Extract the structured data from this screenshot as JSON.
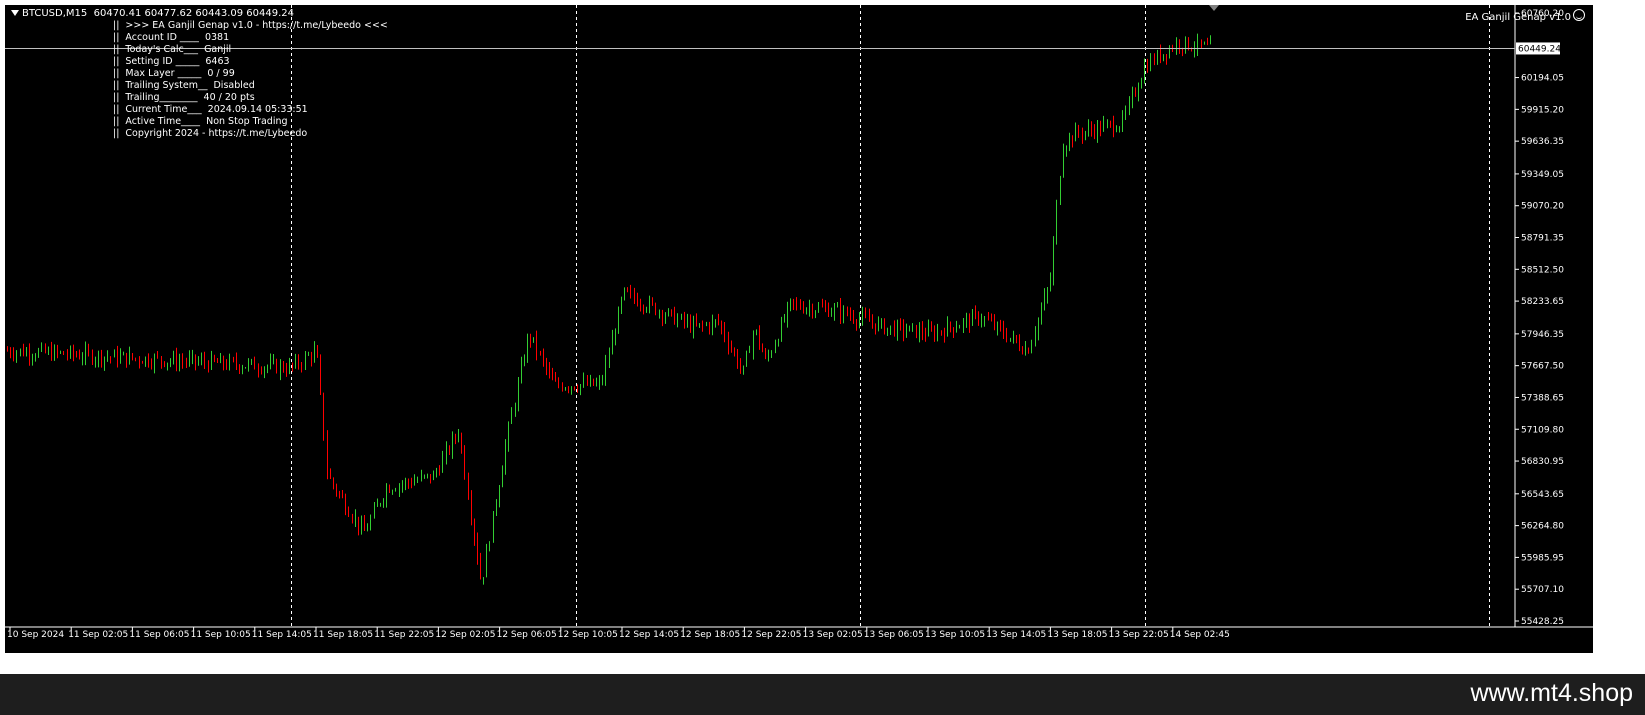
{
  "header": {
    "symbol": "BTCUSD,M15",
    "ohlc": "60470.41 60477.62 60443.09 60449.24"
  },
  "indicator_name": "EA Ganjil Genap v1.0",
  "ea_panel": [
    ">>> EA Ganjil Genap v1.0 - https://t.me/Lybeedo <<<",
    "Account ID ____  0381",
    "Today's Calc___  Ganjil",
    "Setting ID _____  6463",
    "Max Layer _____  0 / 99",
    "Trailing System__  Disabled",
    "Trailing________  40 / 20 pts",
    "Current Time___  2024.09.14 05:33:51",
    "Active Time____  Non Stop Trading",
    "Copyright 2024 - https://t.me/Lybeedo"
  ],
  "watermark": "www.mt4.shop",
  "colors": {
    "background": "#000000",
    "bull_candle": "#32cd32",
    "bear_candle": "#ff0000",
    "grid": "#ffffff",
    "bid_line": "#c0c0c0"
  },
  "chart_data": {
    "type": "candlestick",
    "symbol": "BTCUSD",
    "timeframe": "M15",
    "current_price": "60449.24",
    "y_ticks": [
      "60760.20",
      "60194.05",
      "59915.20",
      "59636.35",
      "59349.05",
      "59070.20",
      "58791.35",
      "58512.50",
      "58233.65",
      "57946.35",
      "57667.50",
      "57388.65",
      "57109.80",
      "56830.95",
      "56543.65",
      "56264.80",
      "55985.95",
      "55707.10",
      "55428.25"
    ],
    "x_ticks": [
      "10 Sep 2024",
      "11 Sep 02:05",
      "11 Sep 06:05",
      "11 Sep 10:05",
      "11 Sep 14:05",
      "11 Sep 18:05",
      "11 Sep 22:05",
      "12 Sep 02:05",
      "12 Sep 06:05",
      "12 Sep 10:05",
      "12 Sep 14:05",
      "12 Sep 18:05",
      "12 Sep 22:05",
      "13 Sep 02:05",
      "13 Sep 06:05",
      "13 Sep 10:05",
      "13 Sep 14:05",
      "13 Sep 18:05",
      "13 Sep 22:05",
      "14 Sep 02:45"
    ],
    "ylim": [
      55428.25,
      60760.2
    ],
    "day_separators": [
      "11 Sep 00:00",
      "12 Sep 00:00",
      "13 Sep 00:00",
      "14 Sep 00:00"
    ],
    "close_path": [
      [
        "10 Sep 2024",
        57800
      ],
      [
        "11 Sep 00:00",
        57650
      ],
      [
        "11 Sep 02:05",
        57800
      ],
      [
        "11 Sep 03:00",
        56700
      ],
      [
        "11 Sep 06:05",
        56200
      ],
      [
        "11 Sep 08:00",
        56600
      ],
      [
        "11 Sep 12:00",
        56700
      ],
      [
        "11 Sep 14:05",
        57100
      ],
      [
        "11 Sep 16:00",
        55750
      ],
      [
        "11 Sep 18:05",
        57000
      ],
      [
        "11 Sep 20:00",
        57950
      ],
      [
        "11 Sep 22:05",
        57500
      ],
      [
        "12 Sep 02:05",
        57500
      ],
      [
        "12 Sep 04:00",
        58300
      ],
      [
        "12 Sep 06:05",
        58200
      ],
      [
        "12 Sep 08:00",
        58100
      ],
      [
        "12 Sep 10:05",
        58000
      ],
      [
        "12 Sep 12:00",
        58050
      ],
      [
        "12 Sep 14:05",
        57600
      ],
      [
        "12 Sep 15:00",
        58000
      ],
      [
        "12 Sep 16:00",
        57700
      ],
      [
        "12 Sep 18:05",
        58200
      ],
      [
        "12 Sep 22:05",
        58150
      ],
      [
        "13 Sep 02:05",
        58000
      ],
      [
        "13 Sep 06:05",
        57950
      ],
      [
        "13 Sep 10:05",
        58100
      ],
      [
        "13 Sep 14:05",
        57800
      ],
      [
        "13 Sep 16:00",
        58400
      ],
      [
        "13 Sep 17:00",
        59600
      ],
      [
        "13 Sep 18:05",
        59700
      ],
      [
        "13 Sep 22:05",
        59800
      ],
      [
        "14 Sep 00:00",
        60300
      ],
      [
        "14 Sep 02:45",
        60500
      ],
      [
        "14 Sep 05:30",
        60449.24
      ]
    ]
  }
}
